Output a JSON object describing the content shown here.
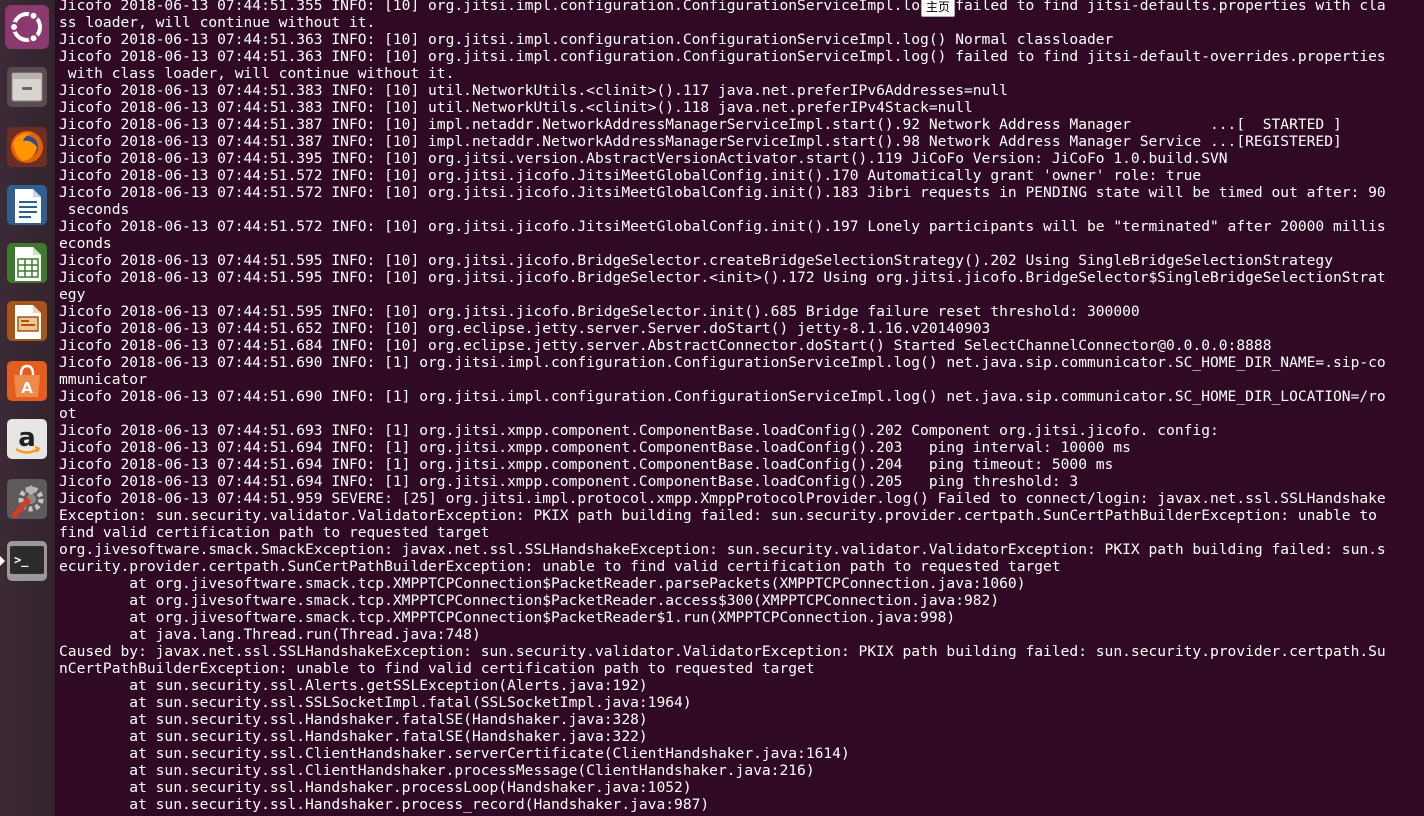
{
  "colors": {
    "terminal_bg": "#300a24",
    "terminal_fg": "#ffffff",
    "launcher_bg": "#3c2b36"
  },
  "launcher": {
    "items": [
      {
        "icon": "ubuntu-logo-icon"
      },
      {
        "icon": "files-icon"
      },
      {
        "icon": "firefox-icon"
      },
      {
        "icon": "libreoffice-writer-icon"
      },
      {
        "icon": "libreoffice-calc-icon"
      },
      {
        "icon": "libreoffice-impress-icon"
      },
      {
        "icon": "software-center-icon"
      },
      {
        "icon": "amazon-icon",
        "letter": "a"
      },
      {
        "icon": "system-settings-icon"
      },
      {
        "icon": "terminal-icon",
        "prompt": ">_"
      }
    ]
  },
  "tooltip": {
    "label": "主页"
  },
  "terminal": {
    "lines": [
      "Jicofo 2018-06-13 07:44:51.355 INFO: [10] org.jitsi.impl.configuration.ConfigurationServiceImpl.log() failed to find jitsi-defaults.properties with cla",
      "ss loader, will continue without it.",
      "Jicofo 2018-06-13 07:44:51.363 INFO: [10] org.jitsi.impl.configuration.ConfigurationServiceImpl.log() Normal classloader",
      "Jicofo 2018-06-13 07:44:51.363 INFO: [10] org.jitsi.impl.configuration.ConfigurationServiceImpl.log() failed to find jitsi-default-overrides.properties",
      " with class loader, will continue without it.",
      "Jicofo 2018-06-13 07:44:51.383 INFO: [10] util.NetworkUtils.<clinit>().117 java.net.preferIPv6Addresses=null",
      "Jicofo 2018-06-13 07:44:51.383 INFO: [10] util.NetworkUtils.<clinit>().118 java.net.preferIPv4Stack=null",
      "Jicofo 2018-06-13 07:44:51.387 INFO: [10] impl.netaddr.NetworkAddressManagerServiceImpl.start().92 Network Address Manager         ...[  STARTED ]",
      "Jicofo 2018-06-13 07:44:51.387 INFO: [10] impl.netaddr.NetworkAddressManagerServiceImpl.start().98 Network Address Manager Service ...[REGISTERED]",
      "Jicofo 2018-06-13 07:44:51.395 INFO: [10] org.jitsi.version.AbstractVersionActivator.start().119 JiCoFo Version: JiCoFo 1.0.build.SVN",
      "Jicofo 2018-06-13 07:44:51.572 INFO: [10] org.jitsi.jicofo.JitsiMeetGlobalConfig.init().170 Automatically grant 'owner' role: true",
      "Jicofo 2018-06-13 07:44:51.572 INFO: [10] org.jitsi.jicofo.JitsiMeetGlobalConfig.init().183 Jibri requests in PENDING state will be timed out after: 90",
      " seconds",
      "Jicofo 2018-06-13 07:44:51.572 INFO: [10] org.jitsi.jicofo.JitsiMeetGlobalConfig.init().197 Lonely participants will be \"terminated\" after 20000 millis",
      "econds",
      "Jicofo 2018-06-13 07:44:51.595 INFO: [10] org.jitsi.jicofo.BridgeSelector.createBridgeSelectionStrategy().202 Using SingleBridgeSelectionStrategy",
      "Jicofo 2018-06-13 07:44:51.595 INFO: [10] org.jitsi.jicofo.BridgeSelector.<init>().172 Using org.jitsi.jicofo.BridgeSelector$SingleBridgeSelectionStrat",
      "egy",
      "Jicofo 2018-06-13 07:44:51.595 INFO: [10] org.jitsi.jicofo.BridgeSelector.init().685 Bridge failure reset threshold: 300000",
      "Jicofo 2018-06-13 07:44:51.652 INFO: [10] org.eclipse.jetty.server.Server.doStart() jetty-8.1.16.v20140903",
      "Jicofo 2018-06-13 07:44:51.684 INFO: [10] org.eclipse.jetty.server.AbstractConnector.doStart() Started SelectChannelConnector@0.0.0.0:8888",
      "Jicofo 2018-06-13 07:44:51.690 INFO: [1] org.jitsi.impl.configuration.ConfigurationServiceImpl.log() net.java.sip.communicator.SC_HOME_DIR_NAME=.sip-co",
      "mmunicator",
      "Jicofo 2018-06-13 07:44:51.690 INFO: [1] org.jitsi.impl.configuration.ConfigurationServiceImpl.log() net.java.sip.communicator.SC_HOME_DIR_LOCATION=/ro",
      "ot",
      "Jicofo 2018-06-13 07:44:51.693 INFO: [1] org.jitsi.xmpp.component.ComponentBase.loadConfig().202 Component org.jitsi.jicofo. config:",
      "Jicofo 2018-06-13 07:44:51.694 INFO: [1] org.jitsi.xmpp.component.ComponentBase.loadConfig().203   ping interval: 10000 ms",
      "Jicofo 2018-06-13 07:44:51.694 INFO: [1] org.jitsi.xmpp.component.ComponentBase.loadConfig().204   ping timeout: 5000 ms",
      "Jicofo 2018-06-13 07:44:51.694 INFO: [1] org.jitsi.xmpp.component.ComponentBase.loadConfig().205   ping threshold: 3",
      "Jicofo 2018-06-13 07:44:51.959 SEVERE: [25] org.jitsi.impl.protocol.xmpp.XmppProtocolProvider.log() Failed to connect/login: javax.net.ssl.SSLHandshake",
      "Exception: sun.security.validator.ValidatorException: PKIX path building failed: sun.security.provider.certpath.SunCertPathBuilderException: unable to",
      "find valid certification path to requested target",
      "org.jivesoftware.smack.SmackException: javax.net.ssl.SSLHandshakeException: sun.security.validator.ValidatorException: PKIX path building failed: sun.s",
      "ecurity.provider.certpath.SunCertPathBuilderException: unable to find valid certification path to requested target",
      "        at org.jivesoftware.smack.tcp.XMPPTCPConnection$PacketReader.parsePackets(XMPPTCPConnection.java:1060)",
      "        at org.jivesoftware.smack.tcp.XMPPTCPConnection$PacketReader.access$300(XMPPTCPConnection.java:982)",
      "        at org.jivesoftware.smack.tcp.XMPPTCPConnection$PacketReader$1.run(XMPPTCPConnection.java:998)",
      "        at java.lang.Thread.run(Thread.java:748)",
      "Caused by: javax.net.ssl.SSLHandshakeException: sun.security.validator.ValidatorException: PKIX path building failed: sun.security.provider.certpath.Su",
      "nCertPathBuilderException: unable to find valid certification path to requested target",
      "        at sun.security.ssl.Alerts.getSSLException(Alerts.java:192)",
      "        at sun.security.ssl.SSLSocketImpl.fatal(SSLSocketImpl.java:1964)",
      "        at sun.security.ssl.Handshaker.fatalSE(Handshaker.java:328)",
      "        at sun.security.ssl.Handshaker.fatalSE(Handshaker.java:322)",
      "        at sun.security.ssl.ClientHandshaker.serverCertificate(ClientHandshaker.java:1614)",
      "        at sun.security.ssl.ClientHandshaker.processMessage(ClientHandshaker.java:216)",
      "        at sun.security.ssl.Handshaker.processLoop(Handshaker.java:1052)",
      "        at sun.security.ssl.Handshaker.process_record(Handshaker.java:987)"
    ]
  }
}
